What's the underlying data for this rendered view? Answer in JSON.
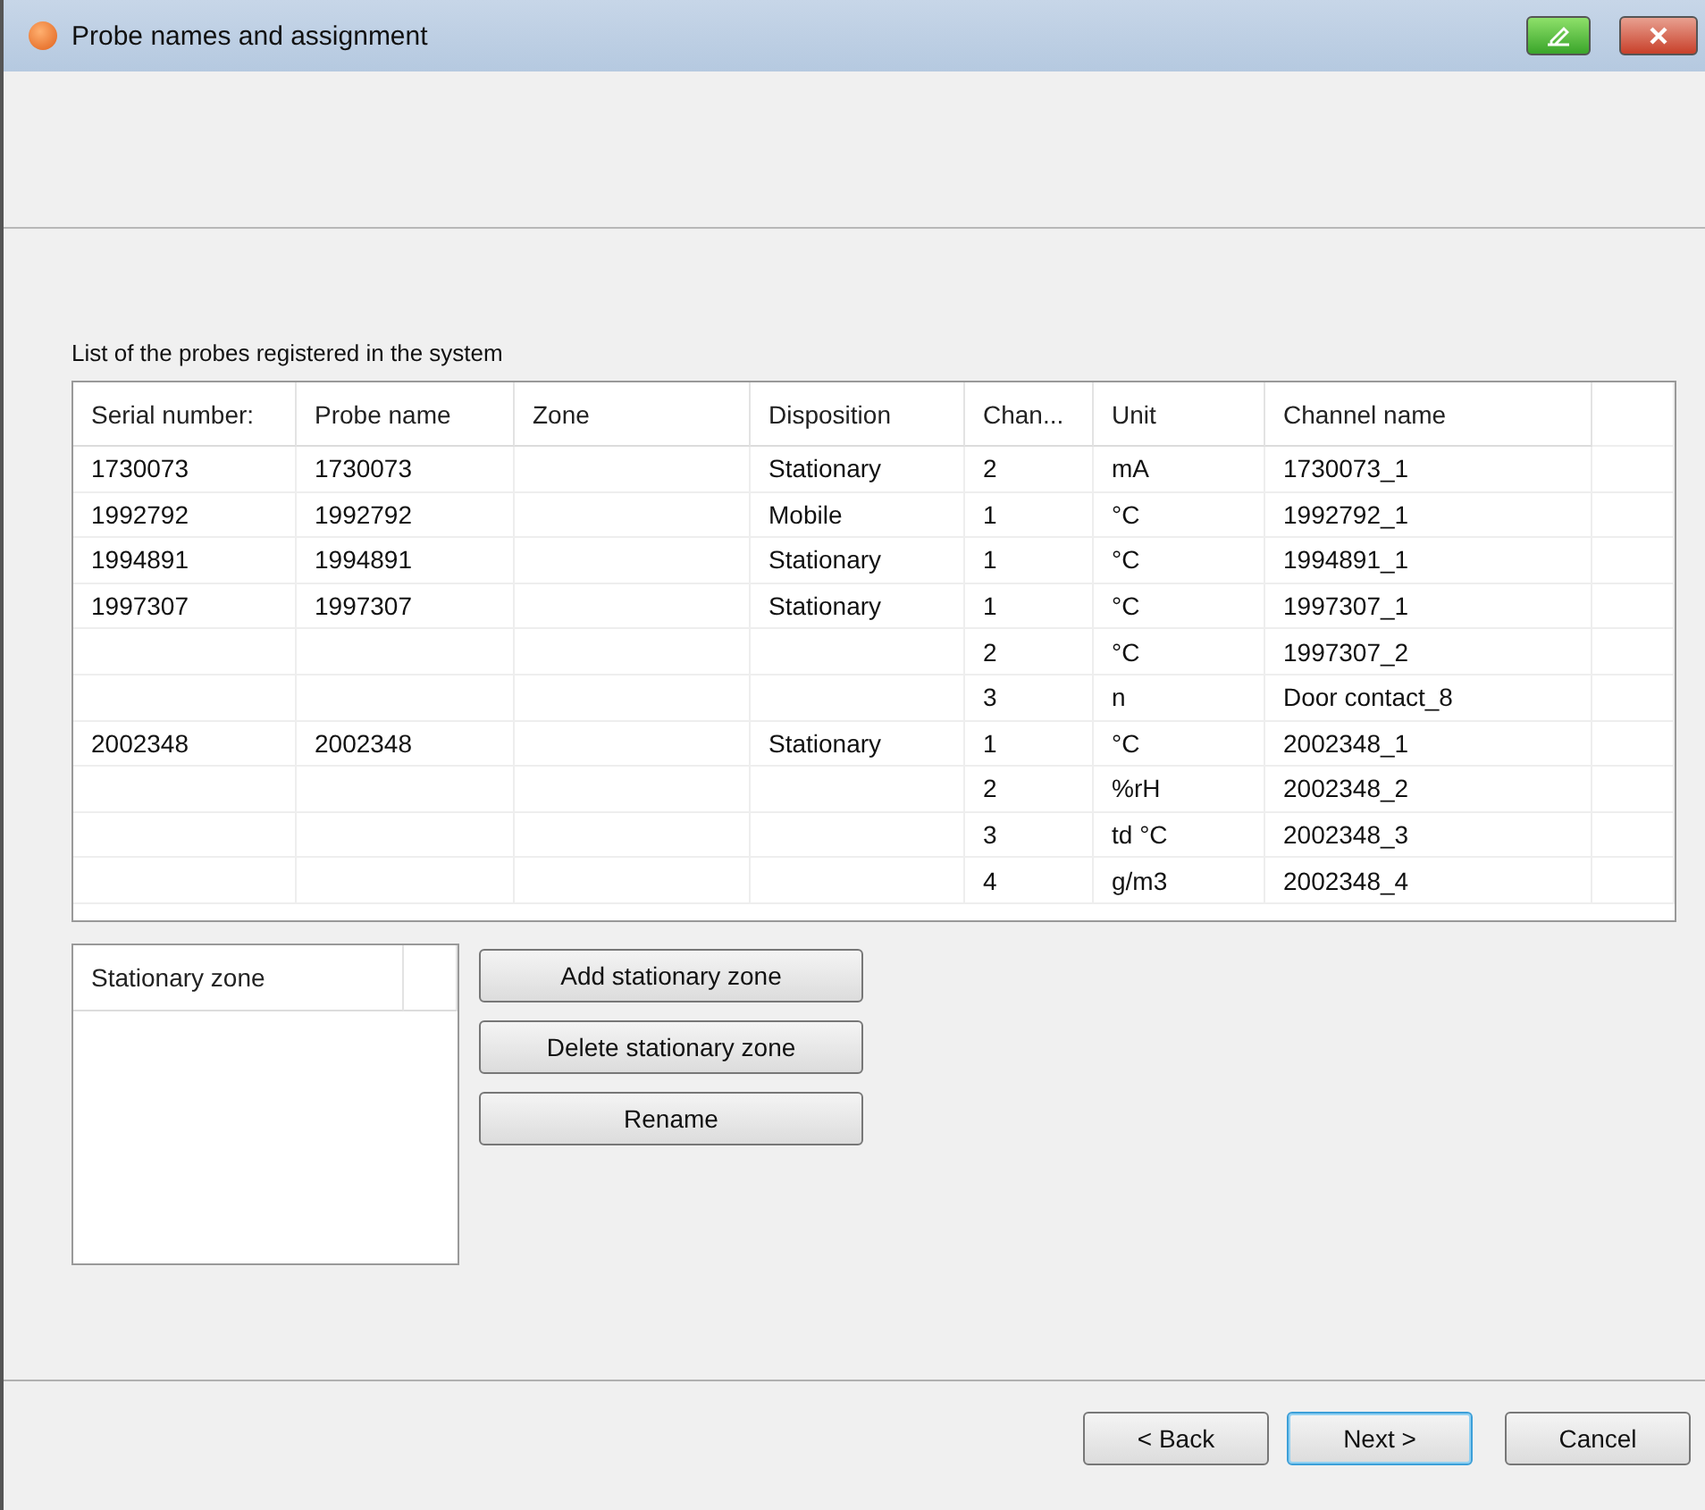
{
  "window": {
    "title": "Probe names and assignment"
  },
  "list_label": "List of the probes registered in the system",
  "table": {
    "columns": [
      "Serial number:",
      "Probe name",
      "Zone",
      "Disposition",
      "Chan...",
      "Unit",
      "Channel name"
    ],
    "rows": [
      [
        "1730073",
        "1730073",
        "",
        "Stationary",
        "2",
        "mA",
        "1730073_1"
      ],
      [
        "1992792",
        "1992792",
        "",
        "Mobile",
        "1",
        "°C",
        "1992792_1"
      ],
      [
        "1994891",
        "1994891",
        "",
        "Stationary",
        "1",
        "°C",
        "1994891_1"
      ],
      [
        "1997307",
        "1997307",
        "",
        "Stationary",
        "1",
        "°C",
        "1997307_1"
      ],
      [
        "",
        "",
        "",
        "",
        "2",
        "°C",
        "1997307_2"
      ],
      [
        "",
        "",
        "",
        "",
        "3",
        "n",
        "Door contact_8"
      ],
      [
        "2002348",
        "2002348",
        "",
        "Stationary",
        "1",
        "°C",
        "2002348_1"
      ],
      [
        "",
        "",
        "",
        "",
        "2",
        "%rH",
        "2002348_2"
      ],
      [
        "",
        "",
        "",
        "",
        "3",
        "td °C",
        "2002348_3"
      ],
      [
        "",
        "",
        "",
        "",
        "4",
        "g/m3",
        "2002348_4"
      ]
    ]
  },
  "zone_list": {
    "column": "Stationary zone"
  },
  "zone_buttons": [
    "Add stationary zone",
    "Delete stationary zone",
    "Rename"
  ],
  "nav_buttons": [
    {
      "label": "< Back",
      "default": false
    },
    {
      "label": "Next >",
      "default": true
    },
    {
      "label": "Cancel",
      "default": false
    }
  ]
}
